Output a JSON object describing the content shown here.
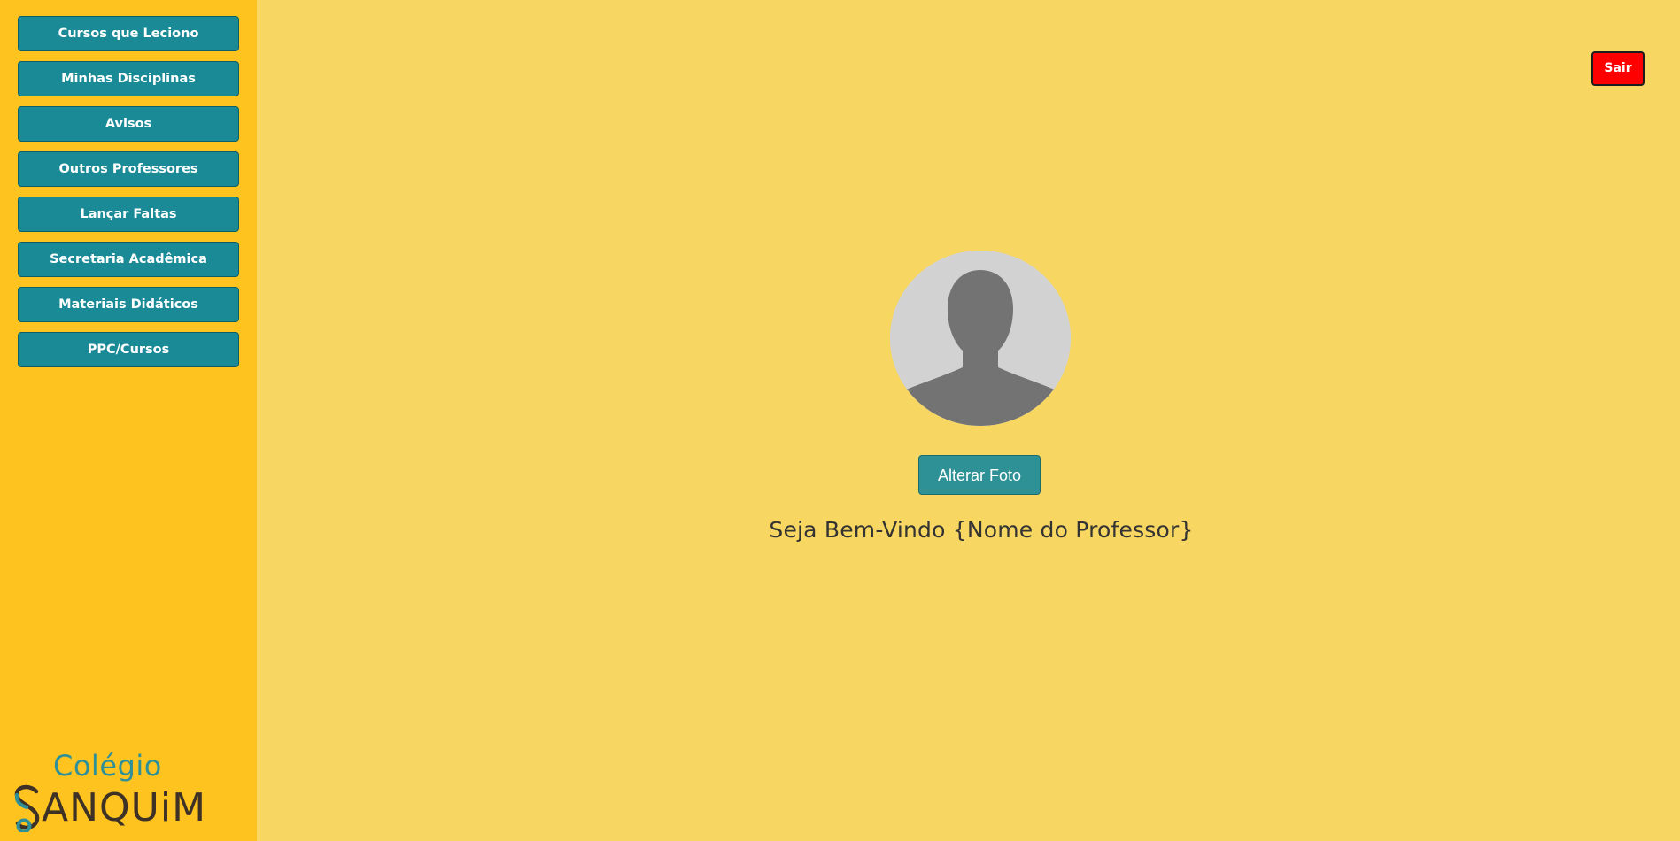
{
  "sidebar": {
    "items": [
      {
        "label": "Cursos que Leciono"
      },
      {
        "label": "Minhas Disciplinas"
      },
      {
        "label": "Avisos"
      },
      {
        "label": "Outros Professores"
      },
      {
        "label": "Lançar Faltas"
      },
      {
        "label": "Secretaria Acadêmica"
      },
      {
        "label": "Materiais Didáticos"
      },
      {
        "label": "PPC/Cursos"
      }
    ],
    "logo": {
      "top_text": "Colégio",
      "bottom_text": "ANQUiM"
    }
  },
  "header": {
    "logout_label": "Sair"
  },
  "main": {
    "avatar_icon": "user-silhouette-icon",
    "change_photo_label": "Alterar Foto",
    "welcome_text": "Seja Bem-Vindo {Nome do Professor}"
  },
  "colors": {
    "page_background": "#f7d661",
    "sidebar_background": "#ffc31f",
    "menu_button": "#1a8b96",
    "logout_button": "#ff0000",
    "change_photo_button": "#2e9196"
  }
}
